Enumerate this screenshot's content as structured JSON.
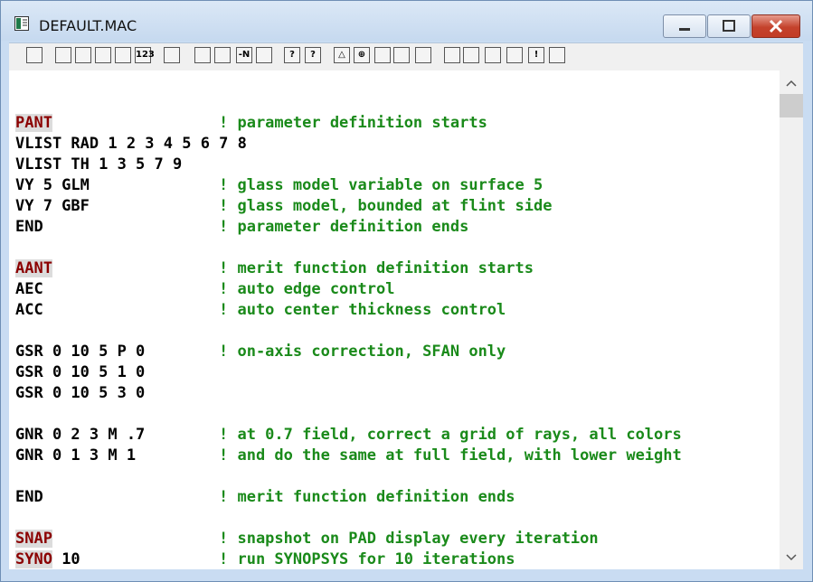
{
  "window": {
    "title": "DEFAULT.MAC"
  },
  "toolbar": {
    "buttons": [
      {
        "icon": "exit-icon",
        "label": ""
      },
      {
        "icon": "open-folder-icon",
        "label": ""
      },
      {
        "icon": "magnifier-icon",
        "label": ""
      },
      {
        "icon": "save-icon",
        "label": ""
      },
      {
        "icon": "save-as-icon",
        "label": ""
      },
      {
        "icon": "numbers-icon",
        "label": "123"
      },
      {
        "icon": "print-icon",
        "label": ""
      },
      {
        "icon": "insert-icon",
        "label": ""
      },
      {
        "icon": "insert-page-icon",
        "label": ""
      },
      {
        "icon": "renumber-icon",
        "label": "-N"
      },
      {
        "icon": "page-icon",
        "label": ""
      },
      {
        "icon": "help-icon",
        "label": "?"
      },
      {
        "icon": "context-help-icon",
        "label": "?"
      },
      {
        "icon": "triangle-icon",
        "label": "△"
      },
      {
        "icon": "crosshair-icon",
        "label": "⊕"
      },
      {
        "icon": "cube-icon",
        "label": ""
      },
      {
        "icon": "wrench-icon",
        "label": ""
      },
      {
        "icon": "gear-icon",
        "label": ""
      },
      {
        "icon": "green-up-arrow-icon",
        "label": ""
      },
      {
        "icon": "indent-icon",
        "label": ""
      },
      {
        "icon": "outdent-icon",
        "label": ""
      },
      {
        "icon": "lines-icon",
        "label": ""
      },
      {
        "icon": "exclamation-icon",
        "label": "!"
      },
      {
        "icon": "stop-icon",
        "label": ""
      }
    ]
  },
  "editor": {
    "lines": [
      {
        "code": "",
        "kw": "",
        "comment": ""
      },
      {
        "code": "",
        "kw": "PANT",
        "comment": "! parameter definition starts"
      },
      {
        "code": "VLIST RAD 1 2 3 4 5 6 7 8",
        "kw": "",
        "comment": ""
      },
      {
        "code": "VLIST TH 1 3 5 7 9",
        "kw": "",
        "comment": ""
      },
      {
        "code": "VY 5 GLM",
        "kw": "",
        "comment": "! glass model variable on surface 5"
      },
      {
        "code": "VY 7 GBF",
        "kw": "",
        "comment": "! glass model, bounded at flint side"
      },
      {
        "code": "END",
        "kw": "",
        "comment": "! parameter definition ends"
      },
      {
        "code": "",
        "kw": "",
        "comment": ""
      },
      {
        "code": "",
        "kw": "AANT",
        "comment": "! merit function definition starts"
      },
      {
        "code": "AEC",
        "kw": "",
        "comment": "! auto edge control"
      },
      {
        "code": "ACC",
        "kw": "",
        "comment": "! auto center thickness control"
      },
      {
        "code": "",
        "kw": "",
        "comment": ""
      },
      {
        "code": "GSR 0 10 5 P 0",
        "kw": "",
        "comment": "! on-axis correction, SFAN only"
      },
      {
        "code": "GSR 0 10 5 1 0",
        "kw": "",
        "comment": ""
      },
      {
        "code": "GSR 0 10 5 3 0",
        "kw": "",
        "comment": ""
      },
      {
        "code": "",
        "kw": "",
        "comment": ""
      },
      {
        "code": "GNR 0 2 3 M .7",
        "kw": "",
        "comment": "! at 0.7 field, correct a grid of rays, all colors"
      },
      {
        "code": "GNR 0 1 3 M 1",
        "kw": "",
        "comment": "! and do the same at full field, with lower weight"
      },
      {
        "code": "",
        "kw": "",
        "comment": ""
      },
      {
        "code": "END",
        "kw": "",
        "comment": "! merit function definition ends"
      },
      {
        "code": "",
        "kw": "",
        "comment": ""
      },
      {
        "code": "",
        "kw": "SNAP",
        "comment": "! snapshot on PAD display every iteration"
      },
      {
        "code": " 10",
        "kw": "SYNO",
        "comment": "! run SYNOPSYS for 10 iterations"
      }
    ]
  }
}
